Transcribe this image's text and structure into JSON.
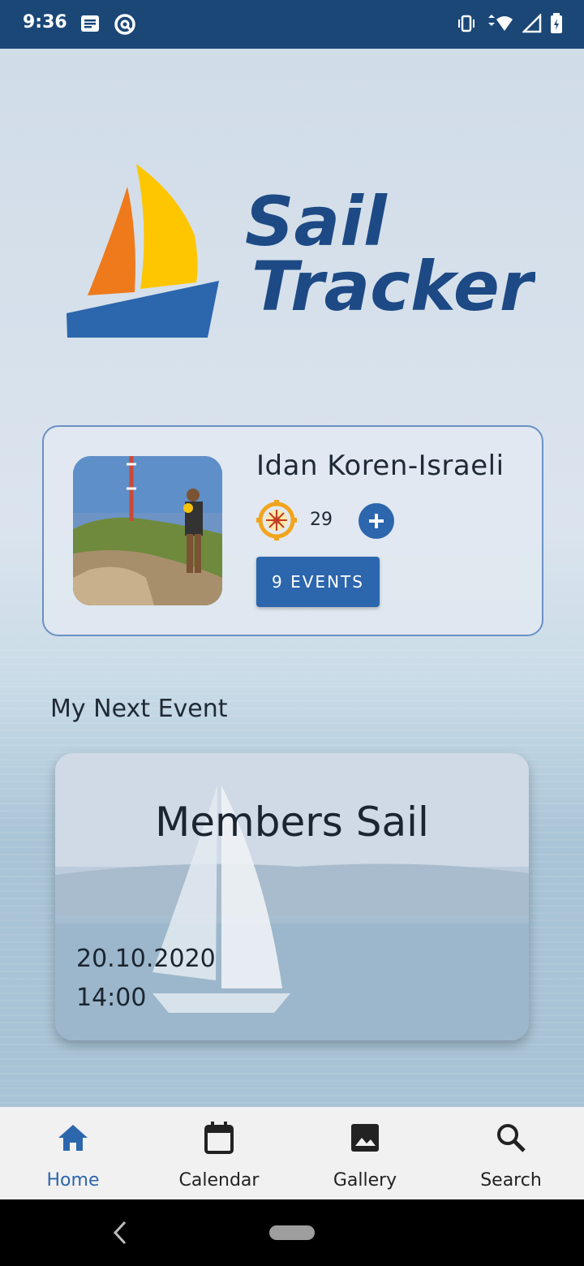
{
  "status_bar": {
    "time": "9:36"
  },
  "app": {
    "logo_line1": "Sail",
    "logo_line2": "Tracker"
  },
  "profile": {
    "name": "Idan Koren-Israeli",
    "points": "29",
    "events_button": "9 EVENTS"
  },
  "next_event": {
    "section_title": "My Next Event",
    "title": "Members Sail",
    "date": "20.10.2020",
    "time": "14:00"
  },
  "bottom_nav": {
    "items": [
      {
        "label": "Home",
        "icon": "home-icon"
      },
      {
        "label": "Calendar",
        "icon": "calendar-icon"
      },
      {
        "label": "Gallery",
        "icon": "gallery-icon"
      },
      {
        "label": "Search",
        "icon": "search-icon"
      }
    ],
    "active_index": 0
  },
  "colors": {
    "primary": "#2c66ad",
    "status_bar": "#1b4777",
    "logo_text": "#1d4a85",
    "sail_orange": "#ee7a1b",
    "sail_yellow": "#fdc600",
    "hull_blue": "#2c66ad"
  }
}
